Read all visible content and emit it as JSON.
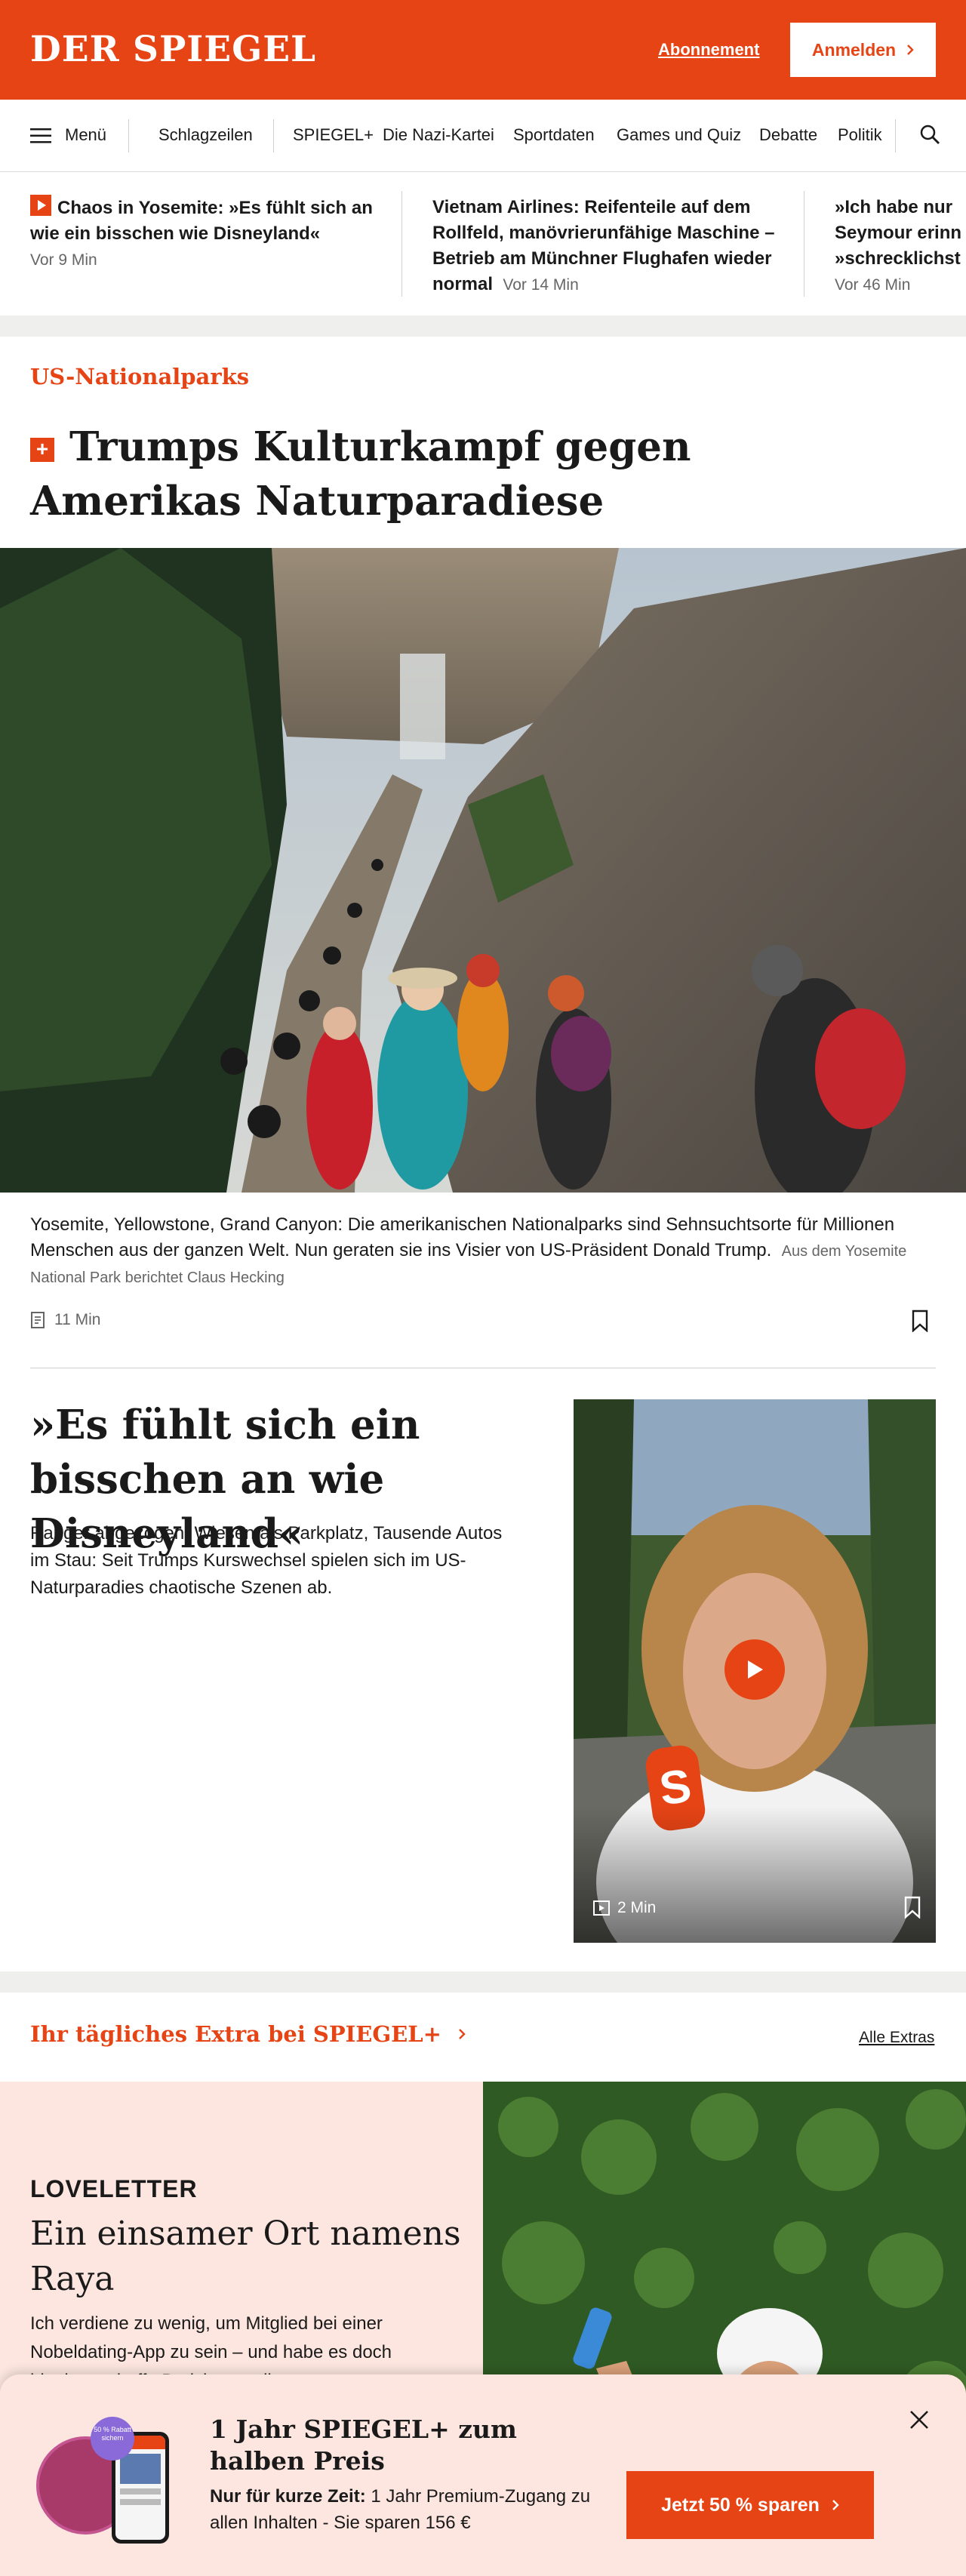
{
  "header": {
    "logo": "DER SPIEGEL",
    "abonnement": "Abonnement",
    "anmelden": "Anmelden",
    "brand_color": "#e64415"
  },
  "nav": {
    "menu_label": "Menü",
    "items": [
      "Schlagzeilen",
      "SPIEGEL+",
      "Die Nazi-Kartei",
      "Sportdaten",
      "Games und Quiz",
      "Debatte",
      "Politik"
    ],
    "icons": [
      "hamburger-icon",
      "search-icon"
    ]
  },
  "ticker": [
    {
      "title": "Chaos in Yosemite: »Es fühlt sich an wie ein bisschen wie Disneyland«",
      "time": "Vor 9 Min"
    },
    {
      "title": "Vietnam Airlines: Reifenteile auf dem Rollfeld, manövrierunfähige Maschine – Betrieb am Münchner Flughafen wieder normal",
      "time": "Vor 14 Min"
    },
    {
      "title": "»Ich habe nur ... Seymour erinn... »schrecklichst...",
      "time": "Vor 46 Min"
    }
  ],
  "article": {
    "kicker": "US-Nationalparks",
    "plus_badge": "+",
    "headline": "Trumps Kulturkampf gegen Amerikas Naturparadiese",
    "teaser": "Yosemite, Yellowstone, Grand Canyon: Die amerikanischen Nationalparks sind Sehnsuchtsorte für Millionen Menschen aus der ganzen Welt. Nun geraten sie ins Visier von US-Präsident Donald Trump.",
    "byline": "Aus dem Yosemite National Park berichtet Claus Hecking",
    "read_time": "11 Min"
  },
  "second": {
    "headline": "»Es fühlt sich ein bisschen an wie Disneyland«",
    "text": "Ranger abgezogen, Wiesen als Parkplatz, Tausende Autos im Stau: Seit Trumps Kurswechsel spielen sich im US-Naturparadies chaotische Szenen ab.",
    "video_time": "2 Min",
    "mic_letter": "S"
  },
  "extras": {
    "heading": "Ihr tägliches Extra bei SPIEGEL+",
    "all_link": "Alle Extras",
    "loveletter": "LOVELETTER",
    "title": "Ein einsamer Ort namens Raya",
    "text": "Ich verdiene zu wenig, um Mitglied bei einer Nobeldating-App zu sein – und habe es doch hineingeschafft. Bericht aus dieser..."
  },
  "promo": {
    "title": "1 Jahr SPIEGEL+ zum halben Preis",
    "text_bold": "Nur für kurze Zeit:",
    "text": " 1 Jahr Premium-Zugang zu allen Inhalten - Sie sparen 156 €",
    "badge": "50 % Rabatt sichern",
    "button": "Jetzt 50 % sparen"
  }
}
